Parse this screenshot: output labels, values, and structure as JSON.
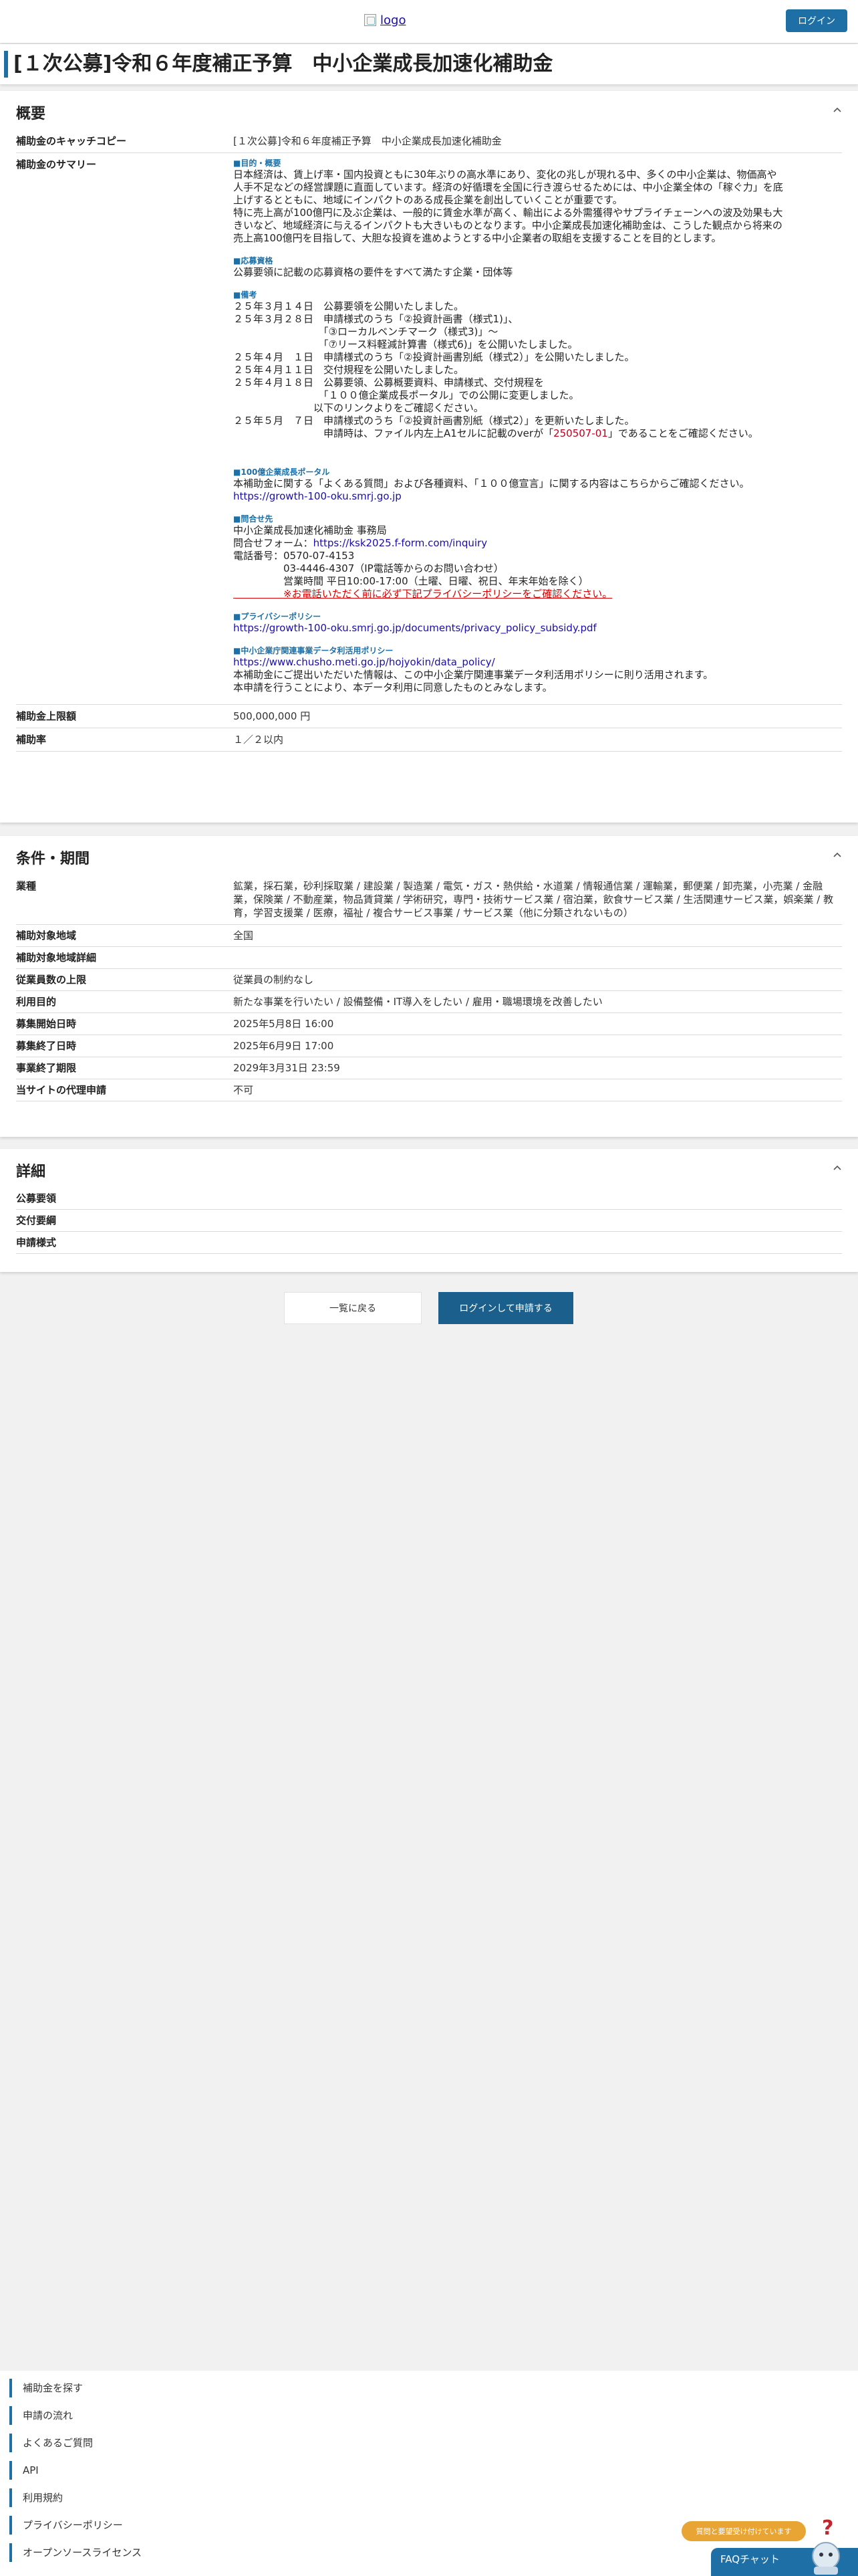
{
  "header": {
    "logo_alt": "logo",
    "login_label": "ログイン"
  },
  "page": {
    "title": "[１次公募]令和６年度補正予算　中小企業成長加速化補助金"
  },
  "overview": {
    "heading": "概要",
    "catchcopy_label": "補助金のキャッチコピー",
    "catchcopy_value": "[１次公募]令和６年度補正予算　中小企業成長加速化補助金",
    "summary_label": "補助金のサマリー",
    "summary": {
      "purpose_heading": "■目的・概要",
      "purpose_lines": [
        "日本経済は、賃上げ率・国内投資ともに30年ぶりの高水準にあり、変化の兆しが現れる中、多くの中小企業は、物価高や",
        "人手不足などの経営課題に直面しています。経済の好循環を全国に行き渡らせるためには、中小企業全体の「稼ぐ力」を底",
        "上げするとともに、地域にインパクトのある成長企業を創出していくことが重要です。",
        "特に売上高が100億円に及ぶ企業は、一般的に賃金水準が高く、輸出による外需獲得やサプライチェーンへの波及効果も大",
        "きいなど、地域経済に与えるインパクトも大きいものとなります。中小企業成長加速化補助金は、こうした観点から将来の",
        "売上高100億円を目指して、大胆な投資を進めようとする中小企業者の取組を支援することを目的とします。"
      ],
      "eligibility_heading": "■応募資格",
      "eligibility_text": "公募要領に記載の応募資格の要件をすべて満たす企業・団体等",
      "notes_heading": "■備考",
      "notes_lines": [
        "２５年３月１４日　公募要領を公開いたしました。",
        "２５年３月２８日　申請様式のうち「②投資計画書（様式1)」、",
        "　　　　　　　　　「③ローカルベンチマーク（様式3)」～",
        "　　　　　　　　　「⑦リース料軽減計算書（様式6)」を公開いたしました。",
        "２５年４月　１日　申請様式のうち「②投資計画書別紙（様式2）」を公開いたしました。",
        "２５年４月１１日　交付規程を公開いたしました。",
        "２５年４月１８日　公募要領、公募概要資料、申請様式、交付規程を",
        "　　　　　　　　　「１００億企業成長ポータル」での公開に変更しました。",
        "　　　　　　　　以下のリンクよりをご確認ください。",
        "２５年５月　７日　申請様式のうち「②投資計画書別紙（様式2）」を更新いたしました。"
      ],
      "notes_last_prefix": "　　　　　　　　　申請時は、ファイル内左上A1セルに記載のverが「",
      "notes_last_red": "250507-01",
      "notes_last_suffix": "」であることをご確認ください。",
      "portal_heading": "■100億企業成長ポータル",
      "portal_text": "本補助金に関する「よくある質問」および各種資料、「１００億宣言」に関する内容はこちらからご確認ください。",
      "portal_link": "https://growth-100-oku.smrj.go.jp",
      "contact_heading": "■問合せ先",
      "contact_org": "中小企業成長加速化補助金 事務局",
      "contact_form_prefix": "問合せフォーム：",
      "contact_form_link": "https://ksk2025.f-form.com/inquiry",
      "contact_phone": "電話番号：0570-07-4153",
      "contact_phone2": "　　　　　03-4446-4307（IP電話等からのお問い合わせ）",
      "contact_hours": "　　　　　営業時間 平日10:00-17:00（土曜、日曜、祝日、年末年始を除く）",
      "contact_warning": "　　　　　※お電話いただく前に必ず下記プライバシーポリシーをご確認ください。",
      "privacy_heading": "■プライバシーポリシー",
      "privacy_link": "https://growth-100-oku.smrj.go.jp/documents/privacy_policy_subsidy.pdf",
      "data_heading": "■中小企業庁関連事業データ利活用ポリシー",
      "data_link": "https://www.chusho.meti.go.jp/hojyokin/data_policy/",
      "data_line1": "本補助金にご提出いただいた情報は、この中小企業庁関連事業データ利活用ポリシーに則り活用されます。",
      "data_line2": "本申請を行うことにより、本データ利用に同意したものとみなします。"
    },
    "limit_label": "補助金上限額",
    "limit_value": "500,000,000 円",
    "rate_label": "補助率",
    "rate_value": "１／２以内"
  },
  "conditions": {
    "heading": "条件・期間",
    "rows": [
      {
        "label": "業種",
        "value": "鉱業，採石業，砂利採取業 / 建設業 / 製造業 / 電気・ガス・熱供給・水道業 / 情報通信業 / 運輸業，郵便業 / 卸売業，小売業 / 金融業，保険業 / 不動産業，物品賃貸業 / 学術研究，専門・技術サービス業 / 宿泊業，飲食サービス業 / 生活関連サービス業，娯楽業 / 教育，学習支援業 / 医療，福祉 / 複合サービス事業 / サービス業（他に分類されないもの）"
      },
      {
        "label": "補助対象地域",
        "value": "全国"
      },
      {
        "label": "補助対象地域詳細",
        "value": ""
      },
      {
        "label": "従業員数の上限",
        "value": "従業員の制約なし"
      },
      {
        "label": "利用目的",
        "value": "新たな事業を行いたい / 設備整備・IT導入をしたい / 雇用・職場環境を改善したい"
      },
      {
        "label": "募集開始日時",
        "value": "2025年5月8日 16:00"
      },
      {
        "label": "募集終了日時",
        "value": "2025年6月9日 17:00"
      },
      {
        "label": "事業終了期限",
        "value": "2029年3月31日 23:59"
      },
      {
        "label": "当サイトの代理申請",
        "value": "不可"
      }
    ]
  },
  "details": {
    "heading": "詳細",
    "rows": [
      {
        "label": "公募要領",
        "value": ""
      },
      {
        "label": "交付要綱",
        "value": ""
      },
      {
        "label": "申請様式",
        "value": ""
      }
    ]
  },
  "actions": {
    "back_label": "一覧に戻る",
    "apply_label": "ログインして申請する"
  },
  "footer": {
    "items": [
      "補助金を探す",
      "申請の流れ",
      "よくあるご質問",
      "API",
      "利用規約",
      "プライバシーポリシー",
      "オープンソースライセンス"
    ]
  },
  "chat": {
    "bubble": "質問と要望受け付けています",
    "faq_label": "FAQチャット"
  },
  "colors": {
    "accent": "#1d6fa5",
    "link": "#1a0dab",
    "warning": "#d80000",
    "help": "#e8a534"
  }
}
